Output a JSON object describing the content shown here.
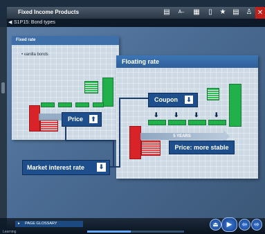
{
  "window": {
    "title": "Fixed Income Products",
    "toolbar_icons": [
      "book-icon",
      "alphabet-icon",
      "dictionary-icon",
      "document-icon",
      "star-icon",
      "notes-icon",
      "person-icon"
    ],
    "close_label": "✕"
  },
  "breadcrumb": {
    "text": "S1P15: Bond types"
  },
  "fixed_panel": {
    "title": "Fixed rate",
    "bullet": "• vanilla bonds"
  },
  "floating_panel": {
    "title": "Floating rate"
  },
  "labels": {
    "price": "Price",
    "coupon": "Coupon",
    "five_years": "5 YEARS",
    "price_stable": "Price: more stable",
    "market_rate": "Market interest rate"
  },
  "bottom": {
    "glossary": "PAGE GLOSSARY",
    "status_left": "Learning",
    "progress": 0.45
  },
  "colors": {
    "panel_header": "#3f6fa8",
    "green": "#22b04a",
    "red": "#d82328",
    "label_box": "#1e4f8c"
  }
}
